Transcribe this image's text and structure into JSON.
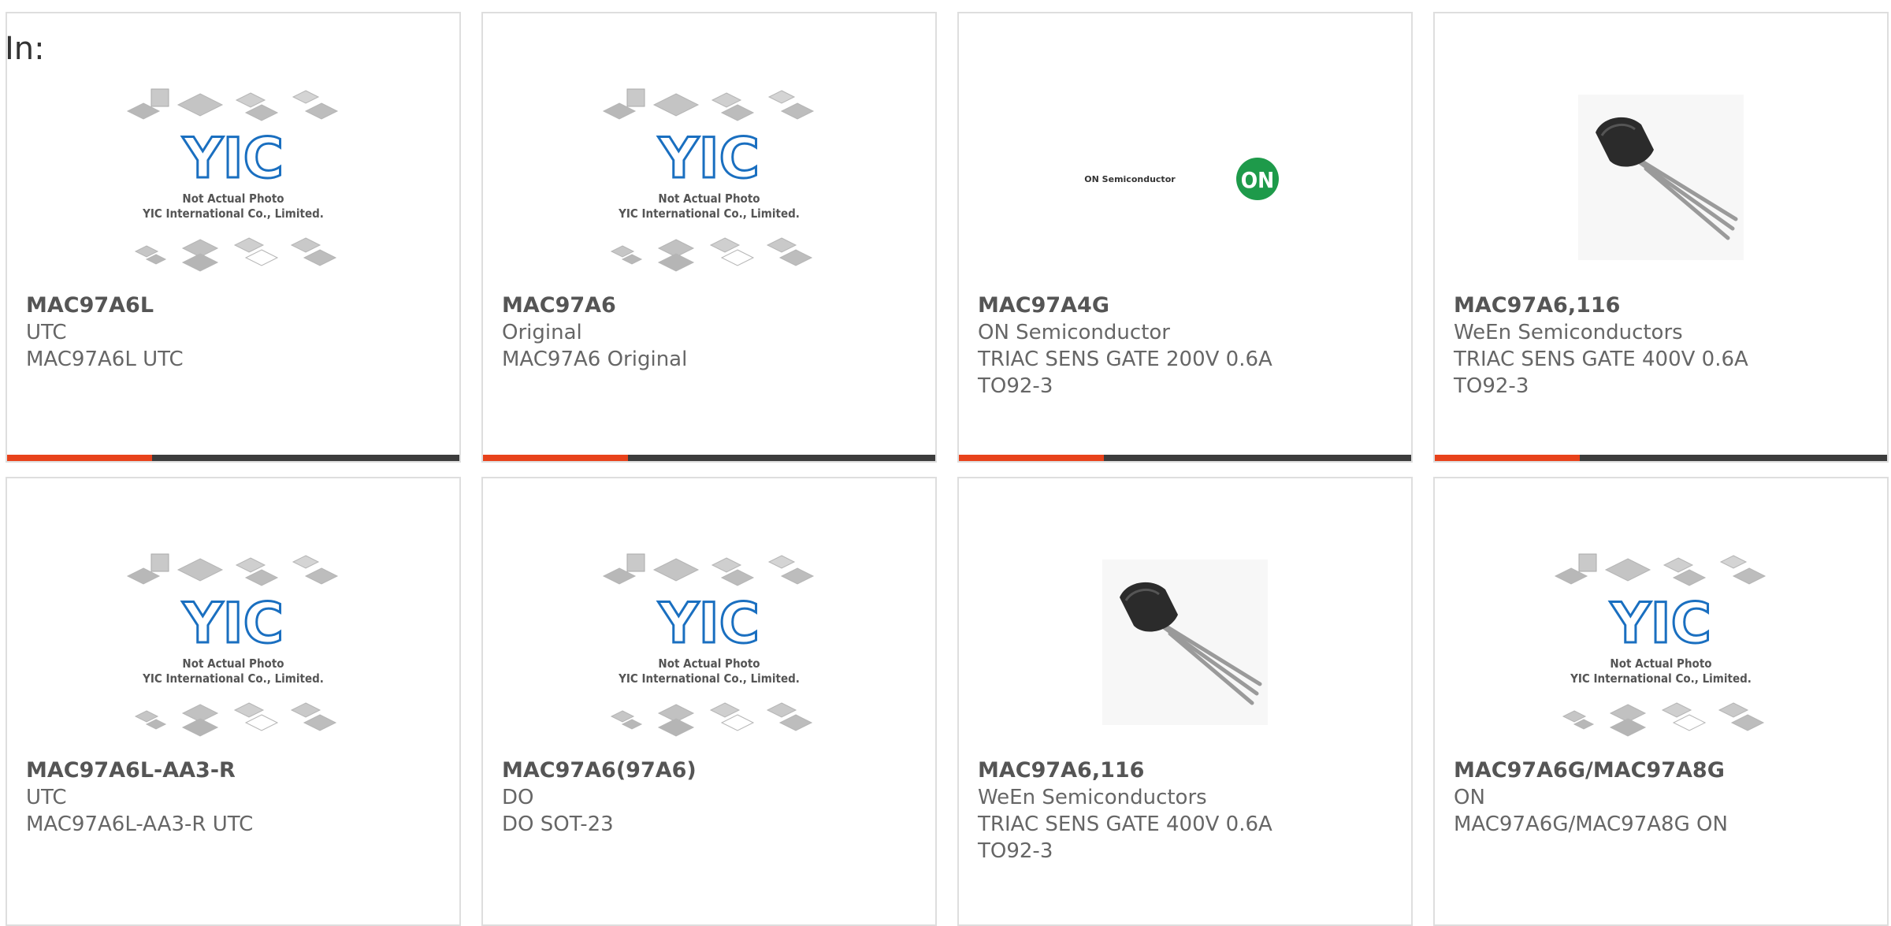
{
  "header": {
    "label": "In:"
  },
  "placeholder_image": {
    "line1": "Not Actual Photo",
    "line2": "YIC International Co., Limited.",
    "logo": "YIC"
  },
  "on_logo": {
    "wordmark": "ON Semiconductor",
    "badge": "ON"
  },
  "cards": [
    {
      "part": "MAC97A6L",
      "maker": "UTC",
      "desc": "MAC97A6L UTC",
      "desc2": "",
      "image": "yic-placeholder"
    },
    {
      "part": "MAC97A6",
      "maker": "Original",
      "desc": "MAC97A6 Original",
      "desc2": "",
      "image": "yic-placeholder"
    },
    {
      "part": "MAC97A4G",
      "maker": "ON Semiconductor",
      "desc": "TRIAC SENS GATE 200V 0.6A",
      "desc2": "TO92-3",
      "image": "on-semiconductor-logo"
    },
    {
      "part": "MAC97A6,116",
      "maker": "WeEn Semiconductors",
      "desc": "TRIAC SENS GATE 400V 0.6A",
      "desc2": "TO92-3",
      "image": "to92-transistor"
    },
    {
      "part": "MAC97A6L-AA3-R",
      "maker": "UTC",
      "desc": "MAC97A6L-AA3-R UTC",
      "desc2": "",
      "image": "yic-placeholder"
    },
    {
      "part": "MAC97A6(97A6)",
      "maker": "DO",
      "desc": "DO SOT-23",
      "desc2": "",
      "image": "yic-placeholder"
    },
    {
      "part": "MAC97A6,116",
      "maker": "WeEn Semiconductors",
      "desc": "TRIAC SENS GATE 400V 0.6A",
      "desc2": "TO92-3",
      "image": "to92-transistor"
    },
    {
      "part": "MAC97A6G/MAC97A8G",
      "maker": "ON",
      "desc": "MAC97A6G/MAC97A8G ON",
      "desc2": "",
      "image": "yic-placeholder"
    }
  ],
  "colors": {
    "accent": "#e8421b",
    "bar": "#3c3c3c",
    "border": "#dedede",
    "yic_blue": "#1a6fc0"
  }
}
